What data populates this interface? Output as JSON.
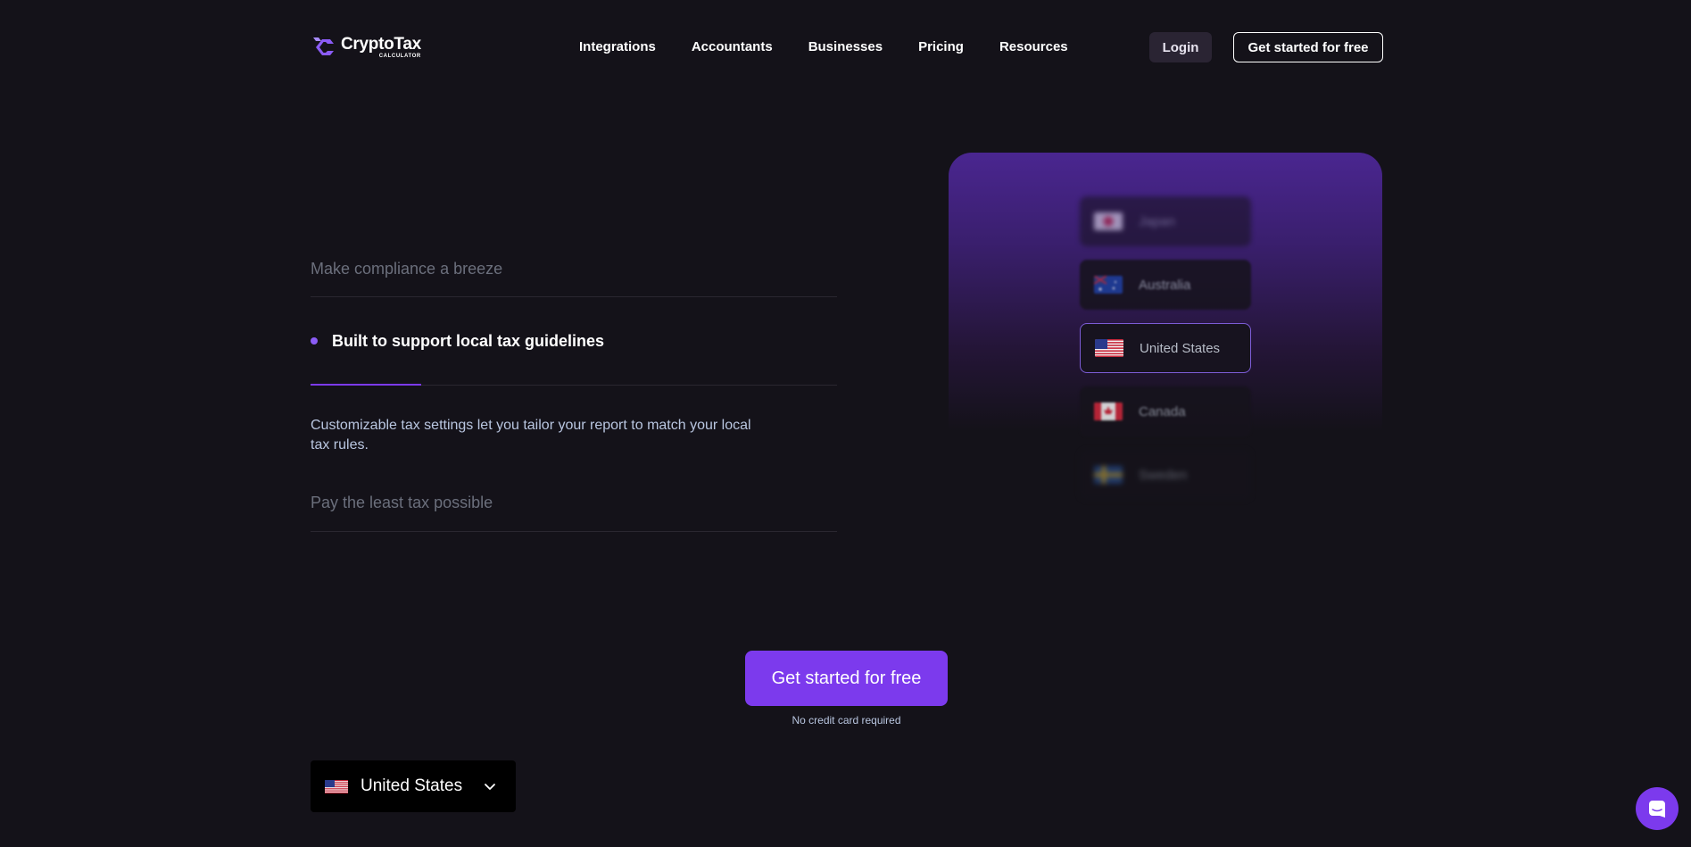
{
  "brand": {
    "name": "CryptoTax",
    "sub": "CALCULATOR",
    "accent": "#7c3aed"
  },
  "nav": {
    "items": [
      "Integrations",
      "Accountants",
      "Businesses",
      "Pricing",
      "Resources"
    ],
    "login": "Login",
    "cta": "Get started for free"
  },
  "features": {
    "items": [
      {
        "title": "Make compliance a breeze",
        "active": false
      },
      {
        "title": "Built to support local tax guidelines",
        "active": true,
        "progress": 0.21,
        "description": "Customizable tax settings let you tailor your report to match your local tax rules."
      },
      {
        "title": "Pay the least tax possible",
        "active": false
      }
    ]
  },
  "country_list": {
    "items": [
      "Japan",
      "Australia",
      "United States",
      "Canada",
      "Sweden"
    ],
    "selected": "United States"
  },
  "cta": {
    "label": "Get started for free",
    "note": "No credit card required"
  },
  "country_selector": {
    "value": "United States",
    "icon": "chevron-down-icon"
  },
  "chat": {
    "icon": "chat-icon"
  }
}
